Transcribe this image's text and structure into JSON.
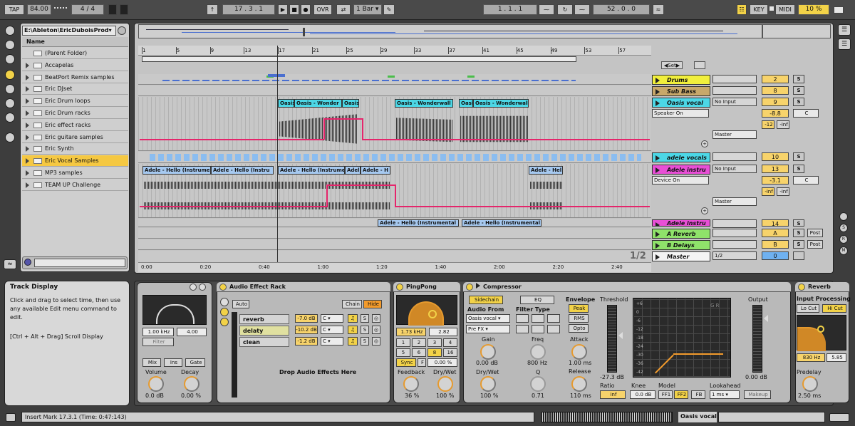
{
  "transport": {
    "tap": "TAP",
    "tempo": "84.00",
    "sig_num": "4",
    "sig_den": "4",
    "position": "17 .  3 .  1",
    "ovr": "OVR",
    "quantize": "1 Bar",
    "loop_start": "1 .  1 .  1",
    "loop_length": "52 .  0 .  0",
    "key": "KEY",
    "midi": "MIDI",
    "cpu": "10 %"
  },
  "browser": {
    "path": "E:\\Ableton\\EricDuboisProd",
    "column": "Name",
    "items": [
      "(Parent Folder)",
      "Accapelas",
      "BeatPort Remix samples",
      "Eric DJset",
      "Eric Drum loops",
      "Eric Drum racks",
      "Eric effect racks",
      "Eric guitare samples",
      "Eric Synth",
      "Eric Vocal Samples",
      "MP3 samples",
      "TEAM UP Challenge"
    ],
    "selected": "Eric Vocal Samples"
  },
  "ruler": {
    "bars": [
      "1",
      "5",
      "9",
      "13",
      "17",
      "21",
      "25",
      "29",
      "33",
      "37",
      "41",
      "45",
      "49",
      "53",
      "57"
    ],
    "times": [
      "0:00",
      "0:20",
      "0:40",
      "1:00",
      "1:20",
      "1:40",
      "2:00",
      "2:20",
      "2:40"
    ],
    "set_label": "Set"
  },
  "clips": {
    "oasis": [
      "Oasis",
      "Oasis - Wonder",
      "Oasis",
      "Oasis - Wonderwall",
      "Oasis",
      "Oasis - Wonderwall"
    ],
    "adele": [
      "Adele - Hello (Instrume",
      "Adele - Hello (Instru",
      "Adele - Hello (Instrume",
      "Adele",
      "Adele - H",
      "Adele - Hel"
    ],
    "adele_lower": [
      "Adele - Hello (Instrumental",
      "Adele - Hello (Instrumental"
    ]
  },
  "tracks": [
    {
      "name": "Drums",
      "color": "#f1ef3c",
      "vol": "2",
      "s": "S"
    },
    {
      "name": "Sub Bass",
      "color": "#c8a86a",
      "vol": "8",
      "s": "S"
    },
    {
      "name": "Oasis vocal",
      "color": "#4cd7e6",
      "vol": "9",
      "s": "S",
      "input": "No Input",
      "monitor": "Speaker On",
      "out": "Master",
      "gain": "-8.8",
      "pan": "C",
      "peak1": "-12",
      "peak2": "-inf"
    },
    {
      "name": "adele vocals",
      "color": "#4cd7e6",
      "vol": "10",
      "s": "S"
    },
    {
      "name": "Adele instru",
      "color": "#e84fd6",
      "vol": "13",
      "s": "S",
      "input": "No Input",
      "monitor": "Device On",
      "out": "Master",
      "gain": "-3.1",
      "pan": "C",
      "peak1": "-inf",
      "peak2": "-inf"
    },
    {
      "name": "Adele instru",
      "color": "#e84fd6",
      "vol": "14",
      "s": "S"
    },
    {
      "name": "A Reverb",
      "color": "#8fe26a",
      "vol": "A",
      "s": "S",
      "post": "Post"
    },
    {
      "name": "B Delays",
      "color": "#8fe26a",
      "vol": "B",
      "s": "S",
      "post": "Post"
    },
    {
      "name": "Master",
      "color": "#f4f4f4",
      "vol": "0",
      "s": "",
      "post": "",
      "split": "1/2"
    }
  ],
  "page_indicator": "1/2",
  "info": {
    "title": "Track Display",
    "text": "Click and drag to select time, then use any available Edit menu command to edit.",
    "shortcut": "[Ctrl + Alt + Drag] Scroll Display"
  },
  "eq_device": {
    "freq": "1.00 kHz",
    "q": "4.00",
    "filter": "Filter",
    "mix": "Mix",
    "ins": "Ins",
    "gate": "Gate",
    "volume_label": "Volume",
    "decay_label": "Decay",
    "volume": "0.0 dB",
    "decay": "0.00 %"
  },
  "rack": {
    "title": "Audio Effect Rack",
    "auto": "Auto",
    "chain": "Chain",
    "hide": "Hide",
    "chains": [
      {
        "name": "reverb",
        "vol": "-7.0 dB",
        "pan": "C"
      },
      {
        "name": "delaty",
        "vol": "-10.2 dB",
        "pan": "C"
      },
      {
        "name": "clean",
        "vol": "-1.2 dB",
        "pan": "C"
      }
    ],
    "drop": "Drop Audio Effects Here"
  },
  "pingpong": {
    "title": "PingPong",
    "freq": "1.73 kHz",
    "width": "2.82",
    "grid": [
      "1",
      "2",
      "3",
      "4",
      "5",
      "6",
      "8",
      "16"
    ],
    "sync": "Sync",
    "f": "F",
    "offset": "0.00 %",
    "feedback_label": "Feedback",
    "drywet_label": "Dry/Wet",
    "feedback": "36 %",
    "drywet": "100 %"
  },
  "compressor": {
    "title": "Compressor",
    "sidechain": "Sidechain",
    "eq": "EQ",
    "audio_from": "Audio From",
    "source": "Oasis vocal",
    "prefx": "Pre FX",
    "gain_label": "Gain",
    "gain": "0.00 dB",
    "drywet_label": "Dry/Wet",
    "drywet": "100 %",
    "filter_type": "Filter Type",
    "freq_label": "Freq",
    "freq": "800 Hz",
    "q_label": "Q",
    "q": "0.71",
    "envelope": "Envelope",
    "peak": "Peak",
    "rms": "RMS",
    "opto": "Opto",
    "attack_label": "Attack",
    "attack": "1.00 ms",
    "release_label": "Release",
    "release": "110 ms",
    "threshold_label": "Threshold",
    "threshold": "-27.3 dB",
    "output_label": "Output",
    "output": "0.00 dB",
    "gr": "G R",
    "scale": [
      "+6",
      "0",
      "-6",
      "-12",
      "-18",
      "-24",
      "-30",
      "-36",
      "-42"
    ],
    "ratio_label": "Ratio",
    "ratio": "inf",
    "knee_label": "Knee",
    "knee": "0.0 dB",
    "model_label": "Model",
    "ff1": "FF1",
    "ff2": "FF2",
    "fb": "FB",
    "lookahead_label": "Lookahead",
    "lookahead": "1 ms",
    "makeup": "Makeup"
  },
  "reverb": {
    "title": "Reverb",
    "input_processing": "Input Processing",
    "locut": "Lo Cut",
    "hicut": "Hi Cut",
    "freq": "830 Hz",
    "width": "5.85",
    "predelay_label": "Predelay",
    "predelay": "2.50 ms"
  },
  "status": {
    "text": "Insert Mark 17.3.1 (Time: 0:47:143)",
    "track": "Oasis vocal"
  },
  "colors": {
    "accent_orange": "#f39b2c",
    "automation": "#e5256b",
    "clip_blue": "#4cd7e6",
    "selected_yellow": "#f5c842"
  }
}
